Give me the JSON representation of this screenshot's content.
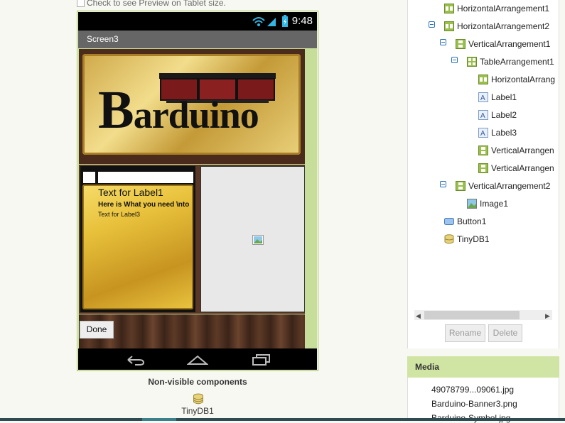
{
  "viewer": {
    "tablet_preview_label": "Check to see Preview on Tablet size.",
    "status_time": "9:48",
    "screen_title": "Screen3",
    "banner_text_rest": "arduino",
    "banner_text_first": "B",
    "label1_text": "Text for Label1",
    "label2_text": "Here is What you need \\nto",
    "label3_text": "Text for Label3",
    "done_label": "Done",
    "nonvisible_title": "Non-visible components",
    "nonvisible_items": [
      "TinyDB1"
    ]
  },
  "components": {
    "items": [
      {
        "label": "HorizontalArrangement1",
        "icon": "horizontal-arrangement-icon"
      },
      {
        "label": "HorizontalArrangement2",
        "icon": "horizontal-arrangement-icon"
      },
      {
        "label": "VerticalArrangement1",
        "icon": "vertical-arrangement-icon"
      },
      {
        "label": "TableArrangement1",
        "icon": "table-arrangement-icon"
      },
      {
        "label": "HorizontalArrang",
        "icon": "horizontal-arrangement-icon"
      },
      {
        "label": "Label1",
        "icon": "label-icon"
      },
      {
        "label": "Label2",
        "icon": "label-icon"
      },
      {
        "label": "Label3",
        "icon": "label-icon"
      },
      {
        "label": "VerticalArrangen",
        "icon": "vertical-arrangement-icon"
      },
      {
        "label": "VerticalArrangen",
        "icon": "vertical-arrangement-icon"
      },
      {
        "label": "VerticalArrangement2",
        "icon": "vertical-arrangement-icon"
      },
      {
        "label": "Image1",
        "icon": "image-icon"
      },
      {
        "label": "Button1",
        "icon": "button-icon"
      },
      {
        "label": "TinyDB1",
        "icon": "tinydb-icon"
      }
    ],
    "rename_label": "Rename",
    "delete_label": "Delete"
  },
  "media": {
    "header": "Media",
    "files": [
      "49078799...09061.jpg",
      "Barduino-Banner3.png",
      "Barduino-Symbol.jpg"
    ]
  },
  "colors": {
    "accent_green": "#9ac04a",
    "media_header": "#d0e4a3",
    "toggle_blue": "#2a6fb3"
  }
}
